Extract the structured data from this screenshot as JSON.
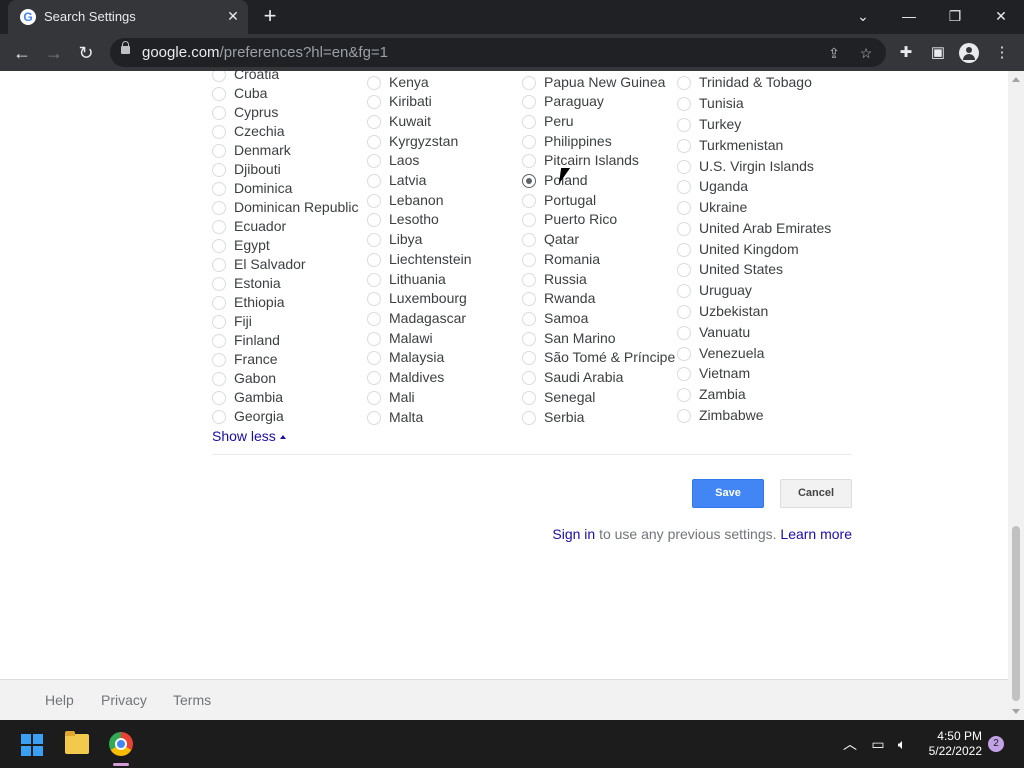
{
  "browser": {
    "tab_title": "Search Settings",
    "favicon_letter": "G",
    "url_domain": "google.com",
    "url_path": "/preferences?hl=en&fg=1"
  },
  "regions": {
    "col1": [
      "Croatia",
      "Cuba",
      "Cyprus",
      "Czechia",
      "Denmark",
      "Djibouti",
      "Dominica",
      "Dominican Republic",
      "Ecuador",
      "Egypt",
      "El Salvador",
      "Estonia",
      "Ethiopia",
      "Fiji",
      "Finland",
      "France",
      "Gabon",
      "Gambia",
      "Georgia"
    ],
    "col2": [
      "Kenya",
      "Kiribati",
      "Kuwait",
      "Kyrgyzstan",
      "Laos",
      "Latvia",
      "Lebanon",
      "Lesotho",
      "Libya",
      "Liechtenstein",
      "Lithuania",
      "Luxembourg",
      "Madagascar",
      "Malawi",
      "Malaysia",
      "Maldives",
      "Mali",
      "Malta"
    ],
    "col3": [
      "Papua New Guinea",
      "Paraguay",
      "Peru",
      "Philippines",
      "Pitcairn Islands",
      "Poland",
      "Portugal",
      "Puerto Rico",
      "Qatar",
      "Romania",
      "Russia",
      "Rwanda",
      "Samoa",
      "San Marino",
      "São Tomé & Príncipe",
      "Saudi Arabia",
      "Senegal",
      "Serbia"
    ],
    "col4": [
      "Trinidad & Tobago",
      "Tunisia",
      "Turkey",
      "Turkmenistan",
      "U.S. Virgin Islands",
      "Uganda",
      "Ukraine",
      "United Arab Emirates",
      "United Kingdom",
      "United States",
      "Uruguay",
      "Uzbekistan",
      "Vanuatu",
      "Venezuela",
      "Vietnam",
      "Zambia",
      "Zimbabwe"
    ],
    "selected": "Poland"
  },
  "show_less": "Show less",
  "save_label": "Save",
  "cancel_label": "Cancel",
  "signin": {
    "link": "Sign in",
    "text": " to use any previous settings. ",
    "learn_more": "Learn more"
  },
  "footer": {
    "help": "Help",
    "privacy": "Privacy",
    "terms": "Terms"
  },
  "taskbar": {
    "time": "4:50 PM",
    "date": "5/22/2022",
    "notifications": "2"
  }
}
